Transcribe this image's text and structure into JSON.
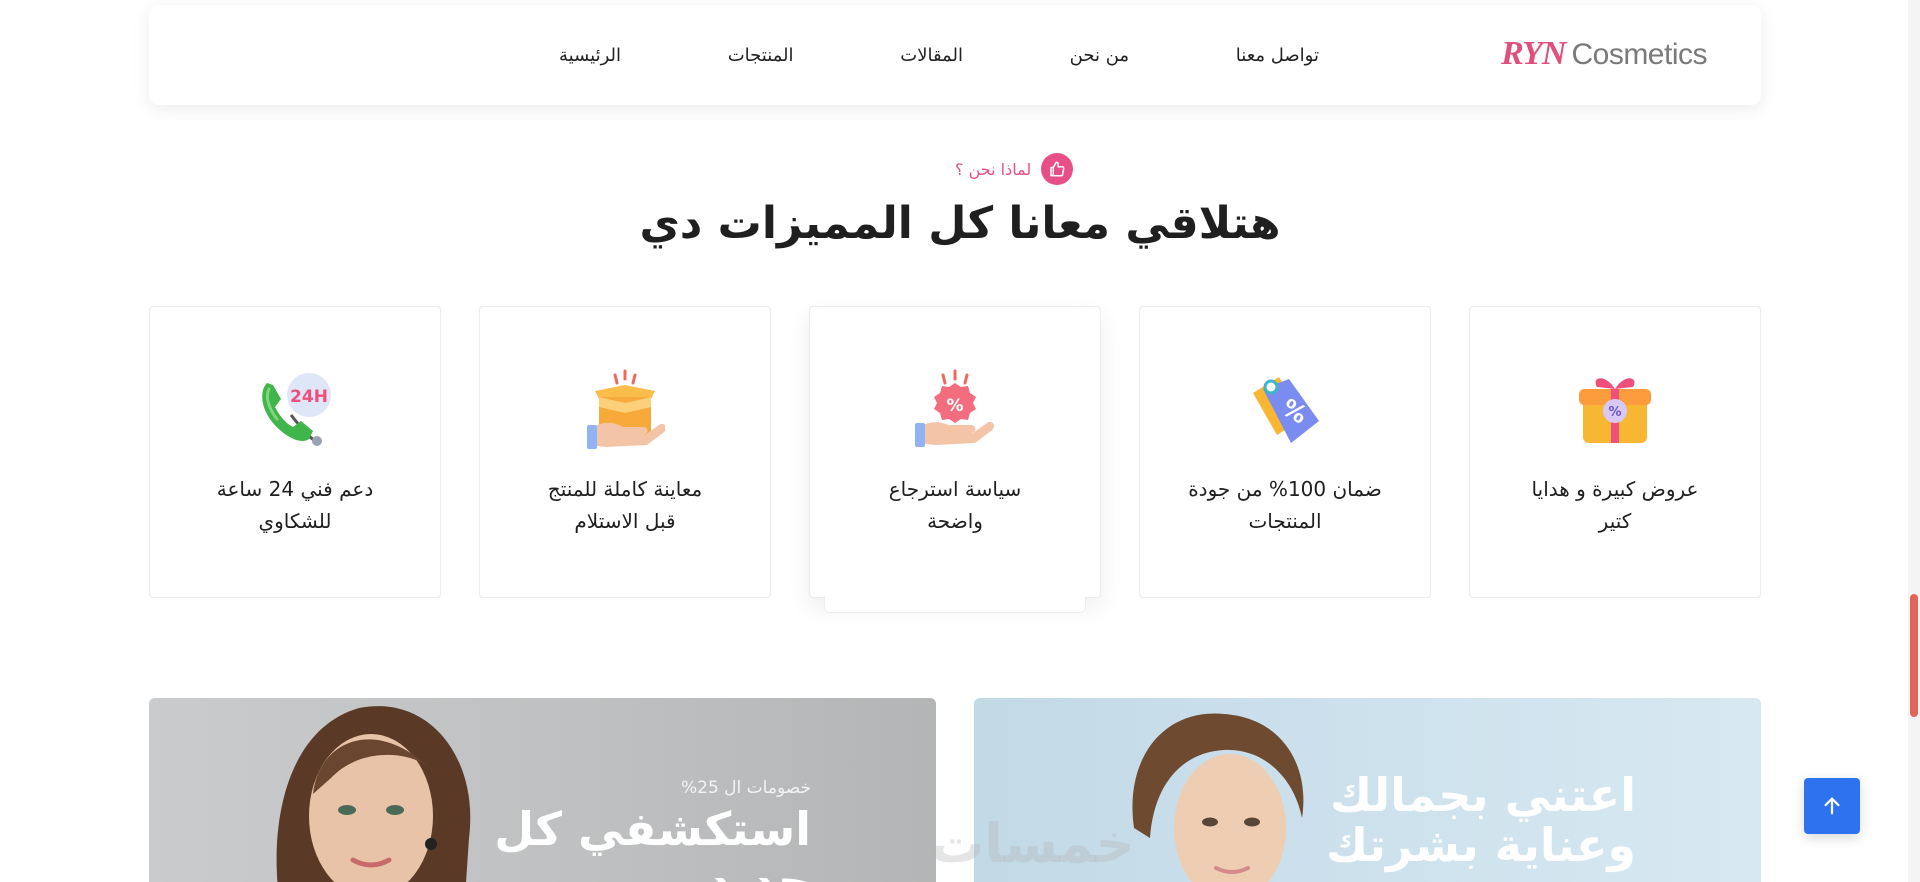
{
  "brand": {
    "logo_mark": "RYN",
    "logo_text": "Cosmetics",
    "accent_color": "#e94f87"
  },
  "nav": {
    "items": [
      "الرئيسية",
      "المنتجات",
      "المقالات",
      "من نحن",
      "تواصل معنا"
    ]
  },
  "section": {
    "tag_icon": "thumbs-up-icon",
    "tag": "لماذا نحن ؟",
    "title": "هتلاقي معانا كل المميزات دي"
  },
  "features": [
    {
      "icon": "gift-percent-icon",
      "line1": "عروض كبيرة و هدايا",
      "line2": "كتير"
    },
    {
      "icon": "price-tag-percent-icon",
      "line1": "ضمان 100% من جودة",
      "line2": "المنتجات"
    },
    {
      "icon": "hand-percent-badge-icon",
      "line1": "سياسة استرجاع",
      "line2": "واضحة"
    },
    {
      "icon": "open-box-hand-icon",
      "line1": "معاينة كاملة للمنتج",
      "line2": "قبل الاستلام"
    },
    {
      "icon": "phone-24h-icon",
      "line1": "دعم فني 24 ساعة",
      "line2": "للشكاوي"
    }
  ],
  "banners": {
    "left": {
      "kicker": "خصومات ال 25%",
      "title": "استكشفي كل جديد"
    },
    "right": {
      "title": "اعتني بجمالك وعناية بشرتك"
    }
  },
  "watermark": "خمسات",
  "back_to_top": {
    "icon": "arrow-up-icon",
    "color": "#2f72f0"
  }
}
